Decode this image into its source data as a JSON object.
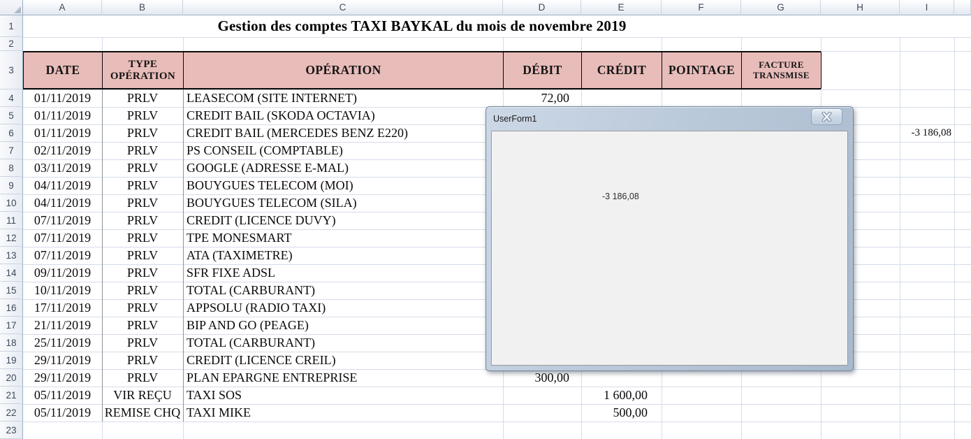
{
  "title": "Gestion des comptes TAXI BAYKAL du mois de novembre 2019",
  "columns": [
    "A",
    "B",
    "C",
    "D",
    "E",
    "F",
    "G",
    "H",
    "I"
  ],
  "row_numbers": [
    "1",
    "2",
    "3",
    "4",
    "5",
    "6",
    "7",
    "8",
    "9",
    "10",
    "11",
    "12",
    "13",
    "14",
    "15",
    "16",
    "17",
    "18",
    "19",
    "20",
    "21",
    "22",
    "23"
  ],
  "table": {
    "headers": [
      "DATE",
      "TYPE OPÉRATION",
      "OPÉRATION",
      "DÉBIT",
      "CRÉDIT",
      "POINTAGE",
      "FACTURE TRANSMISE"
    ],
    "rows": [
      {
        "row": 4,
        "date": "01/11/2019",
        "type": "PRLV",
        "operation": "LEASECOM (SITE INTERNET)",
        "debit": "72,00",
        "credit": ""
      },
      {
        "row": 5,
        "date": "01/11/2019",
        "type": "PRLV",
        "operation": "CREDIT BAIL (SKODA OCTAVIA)",
        "debit": "",
        "credit": ""
      },
      {
        "row": 6,
        "date": "01/11/2019",
        "type": "PRLV",
        "operation": "CREDIT BAIL (MERCEDES BENZ E220)",
        "debit": "",
        "credit": ""
      },
      {
        "row": 7,
        "date": "02/11/2019",
        "type": "PRLV",
        "operation": "PS CONSEIL (COMPTABLE)",
        "debit": "",
        "credit": ""
      },
      {
        "row": 8,
        "date": "03/11/2019",
        "type": "PRLV",
        "operation": "GOOGLE (ADRESSE E-MAL)",
        "debit": "",
        "credit": ""
      },
      {
        "row": 9,
        "date": "04/11/2019",
        "type": "PRLV",
        "operation": "BOUYGUES TELECOM (MOI)",
        "debit": "",
        "credit": ""
      },
      {
        "row": 10,
        "date": "04/11/2019",
        "type": "PRLV",
        "operation": "BOUYGUES TELECOM (SILA)",
        "debit": "",
        "credit": ""
      },
      {
        "row": 11,
        "date": "07/11/2019",
        "type": "PRLV",
        "operation": "CREDIT (LICENCE DUVY)",
        "debit": "",
        "credit": ""
      },
      {
        "row": 12,
        "date": "07/11/2019",
        "type": "PRLV",
        "operation": "TPE MONESMART",
        "debit": "",
        "credit": ""
      },
      {
        "row": 13,
        "date": "07/11/2019",
        "type": "PRLV",
        "operation": "ATA (TAXIMETRE)",
        "debit": "",
        "credit": ""
      },
      {
        "row": 14,
        "date": "09/11/2019",
        "type": "PRLV",
        "operation": "SFR FIXE ADSL",
        "debit": "",
        "credit": ""
      },
      {
        "row": 15,
        "date": "10/11/2019",
        "type": "PRLV",
        "operation": "TOTAL (CARBURANT)",
        "debit": "",
        "credit": ""
      },
      {
        "row": 16,
        "date": "17/11/2019",
        "type": "PRLV",
        "operation": "APPSOLU (RADIO TAXI)",
        "debit": "",
        "credit": ""
      },
      {
        "row": 17,
        "date": "21/11/2019",
        "type": "PRLV",
        "operation": "BIP AND GO (PEAGE)",
        "debit": "",
        "credit": ""
      },
      {
        "row": 18,
        "date": "25/11/2019",
        "type": "PRLV",
        "operation": "TOTAL (CARBURANT)",
        "debit": "",
        "credit": ""
      },
      {
        "row": 19,
        "date": "29/11/2019",
        "type": "PRLV",
        "operation": "CREDIT (LICENCE CREIL)",
        "debit": "",
        "credit": ""
      },
      {
        "row": 20,
        "date": "29/11/2019",
        "type": "PRLV",
        "operation": "PLAN EPARGNE ENTREPRISE",
        "debit": "300,00",
        "credit": ""
      },
      {
        "row": 21,
        "date": "05/11/2019",
        "type": "VIR REÇU",
        "operation": "TAXI SOS",
        "debit": "",
        "credit": "1 600,00"
      },
      {
        "row": 22,
        "date": "05/11/2019",
        "type": "REMISE CHQ",
        "operation": "TAXI MIKE",
        "debit": "",
        "credit": "500,00"
      }
    ]
  },
  "extra_cells": [
    {
      "col": "I",
      "row": 6,
      "value": "-3 186,08"
    }
  ],
  "dialog": {
    "title": "UserForm1",
    "value": "-3 186,08"
  },
  "colors": {
    "table_header_fill": "#e8bcb9",
    "gridline": "#d5dce8",
    "dialog_frame": "#b4c4d6"
  }
}
